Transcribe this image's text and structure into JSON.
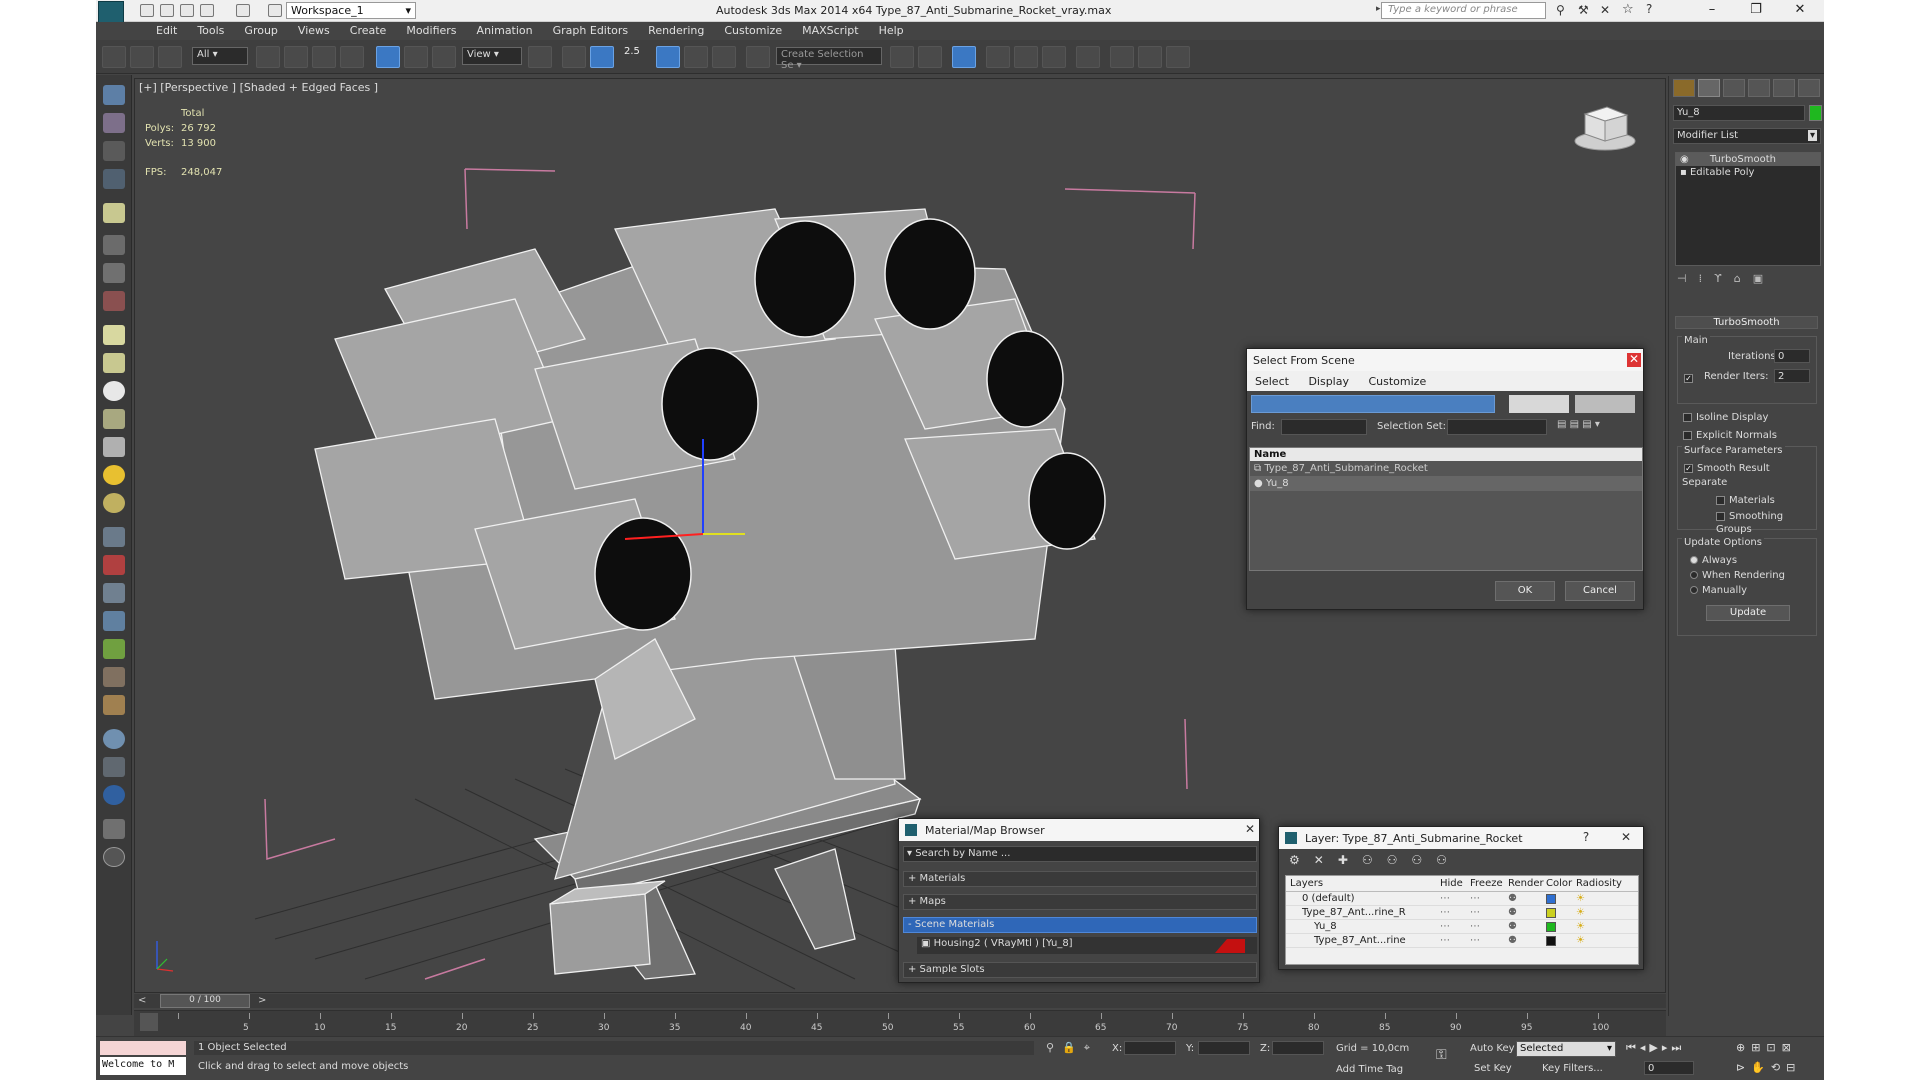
{
  "app": {
    "title": "Autodesk 3ds Max  2014 x64     Type_87_Anti_Submarine_Rocket_vray.max",
    "workspace": "Workspace_1",
    "search_placeholder": "Type a keyword or phrase"
  },
  "menu": [
    "Edit",
    "Tools",
    "Group",
    "Views",
    "Create",
    "Modifiers",
    "Animation",
    "Graph Editors",
    "Rendering",
    "Customize",
    "MAXScript",
    "Help"
  ],
  "toolbar": {
    "filter": "All",
    "ref_coord": "View",
    "snap_angle": "2.5",
    "selection_set": "Create Selection Se"
  },
  "viewport": {
    "label": "[+] [Perspective ] [Shaded + Edged Faces ]",
    "stats": {
      "total": "Total",
      "polys_label": "Polys:",
      "polys": "26 792",
      "verts_label": "Verts:",
      "verts": "13 900",
      "fps_label": "FPS:",
      "fps": "248,047"
    }
  },
  "command_panel": {
    "object_name": "Yu_8",
    "object_color": "#1fb81f",
    "modifier_list": "Modifier List",
    "stack": [
      "TurboSmooth",
      "Editable Poly"
    ],
    "rollout": "TurboSmooth",
    "main": "Main",
    "iterations_label": "Iterations:",
    "iterations": "0",
    "render_iters_label": "Render Iters:",
    "render_iters": "2",
    "isoline": "Isoline Display",
    "explicit": "Explicit Normals",
    "surface_params": "Surface Parameters",
    "smooth_result": "Smooth Result",
    "separate": "Separate",
    "materials": "Materials",
    "smoothing_groups": "Smoothing Groups",
    "update_options": "Update Options",
    "always": "Always",
    "when_rendering": "When Rendering",
    "manually": "Manually",
    "update": "Update"
  },
  "select_dialog": {
    "title": "Select From Scene",
    "menus": [
      "Select",
      "Display",
      "Customize"
    ],
    "find_label": "Find:",
    "selection_set_label": "Selection Set:",
    "col_name": "Name",
    "items": [
      "Type_87_Anti_Submarine_Rocket",
      "Yu_8"
    ],
    "ok": "OK",
    "cancel": "Cancel"
  },
  "material_browser": {
    "title": "Material/Map Browser",
    "search": "Search by Name ...",
    "groups": [
      "+ Materials",
      "+ Maps",
      "- Scene Materials",
      "+ Sample Slots"
    ],
    "scene_item": "Housing2  ( VRayMtl )  [Yu_8]"
  },
  "layer_dialog": {
    "title": "Layer: Type_87_Anti_Submarine_Rocket",
    "help": "?",
    "columns": [
      "Layers",
      "Hide",
      "Freeze",
      "Render",
      "Color",
      "Radiosity"
    ],
    "rows": [
      {
        "name": "0 (default)",
        "color": "#2f6fd0"
      },
      {
        "name": "Type_87_Ant...rine_R",
        "color": "#cbd020"
      },
      {
        "name": "Yu_8",
        "color": "#1fb81f"
      },
      {
        "name": "Type_87_Ant...rine",
        "color": "#111111"
      }
    ]
  },
  "timeline": {
    "frame": "0 / 100",
    "ticks": [
      "0",
      "5",
      "10",
      "15",
      "20",
      "25",
      "30",
      "35",
      "40",
      "45",
      "50",
      "55",
      "60",
      "65",
      "70",
      "75",
      "80",
      "85",
      "90",
      "95",
      "100"
    ]
  },
  "status": {
    "welcome": "Welcome to M",
    "selected": "1 Object Selected",
    "prompt": "Click and drag to select and move objects",
    "x_label": "X:",
    "y_label": "Y:",
    "z_label": "Z:",
    "grid": "Grid = 10,0cm",
    "add_time_tag": "Add Time Tag",
    "auto_key": "Auto Key",
    "set_key": "Set Key",
    "selected_dd": "Selected",
    "key_filters": "Key Filters...",
    "frame_val": "0"
  }
}
